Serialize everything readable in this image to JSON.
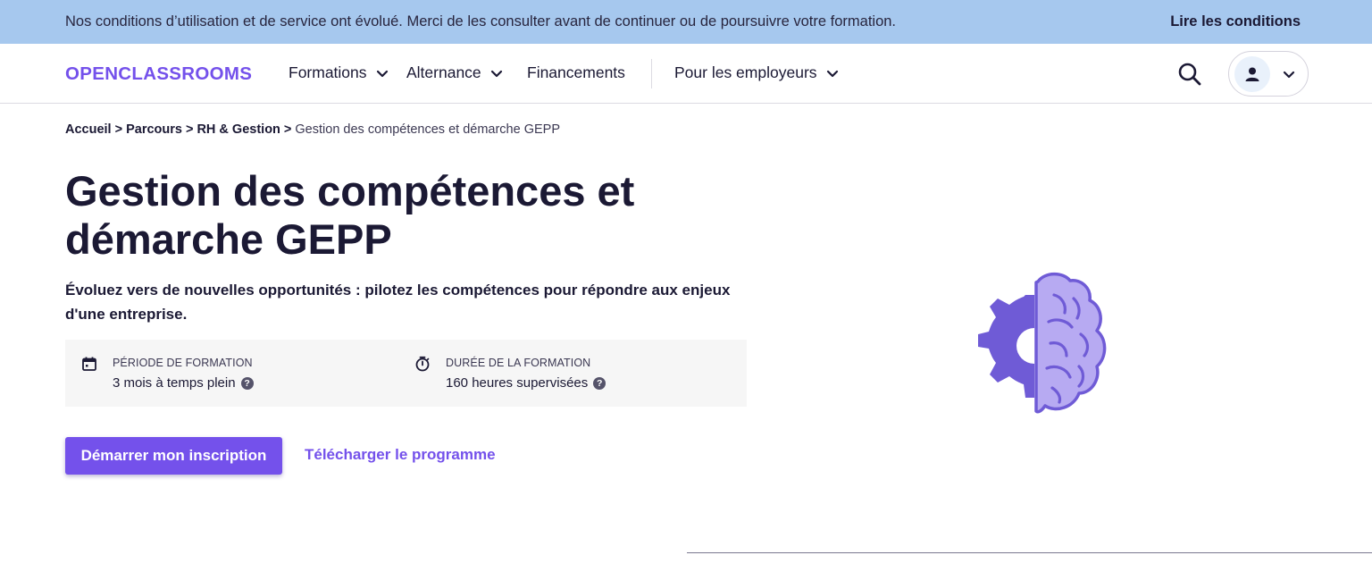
{
  "banner": {
    "text": "Nos conditions d’utilisation et de service ont évolué. Merci de les consulter avant de continuer ou de poursuivre votre formation.",
    "link": "Lire les conditions"
  },
  "nav": {
    "logo": "OPENCLASSROOMS",
    "items": [
      {
        "label": "Formations"
      },
      {
        "label": "Alternance"
      },
      {
        "label": "Financements"
      },
      {
        "label": "Pour les employeurs"
      }
    ]
  },
  "breadcrumb": {
    "items": [
      "Accueil >",
      "Parcours >",
      "RH & Gestion >"
    ],
    "current": "Gestion des compétences et démarche GEPP"
  },
  "page": {
    "title": "Gestion des compétences et démarche GEPP",
    "subtitle": "Évoluez vers de nouvelles opportunités : pilotez les compétences pour répondre aux enjeux d'une entreprise."
  },
  "info": {
    "period": {
      "label": "PÉRIODE DE FORMATION",
      "value": "3 mois à temps plein"
    },
    "duration": {
      "label": "DURÉE DE LA FORMATION",
      "value": "160 heures supervisées"
    },
    "help_glyph": "?"
  },
  "actions": {
    "start": "Démarrer mon inscription",
    "download": "Télécharger le programme"
  },
  "colors": {
    "brand": "#7451eb",
    "banner": "#a6c8ee",
    "text": "#1b1934",
    "illustration_dark": "#6f5bd6",
    "illustration_light": "#b7aaf2"
  },
  "icons": [
    "calendar-icon",
    "stopwatch-icon",
    "help-icon",
    "search-icon",
    "user-icon",
    "chevron-down-icon",
    "brain-gear-illustration"
  ]
}
